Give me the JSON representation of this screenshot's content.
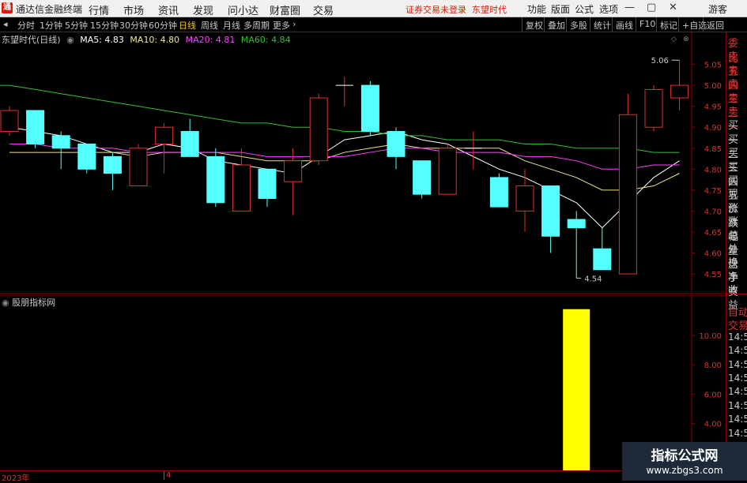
{
  "titlebar": {
    "app_name": "通达信金融终端",
    "menu": [
      "行情",
      "市场",
      "资讯",
      "发现",
      "问小达",
      "财富圈",
      "交易"
    ],
    "notice": "证券交易未登录",
    "notice_stock": "东望时代",
    "right_menu": [
      "功能",
      "版面",
      "公式",
      "选项"
    ],
    "user": "游客"
  },
  "toolbar": {
    "periods": [
      "分时",
      "1分钟",
      "5分钟",
      "15分钟",
      "30分钟",
      "60分钟",
      "日线",
      "周线",
      "月线",
      "多周期",
      "更多"
    ],
    "active_period": "日线",
    "right_buttons": [
      "复权",
      "叠加",
      "多股",
      "统计",
      "画线",
      "F10",
      "标记",
      "+自选",
      "返回"
    ]
  },
  "chart_info": {
    "stock_title": "东望时代(日线)",
    "ma5_label": "MA5: 4.83",
    "ma10_label": "MA10: 4.80",
    "ma20_label": "MA20: 4.81",
    "ma60_label": "MA60: 4.84",
    "colors": {
      "ma5": "#ffffff",
      "ma10": "#f0e68c",
      "ma20": "#ff40ff",
      "ma60": "#30c030",
      "up": "#e03030",
      "down": "#54ffff",
      "grid": "#8b0000",
      "bar": "#ffff00"
    }
  },
  "indicator": {
    "title": "股朋指标网"
  },
  "right_panel": {
    "items_top": [
      "委比",
      "卖五",
      "卖四",
      "卖三",
      "卖二",
      "卖一",
      "买一",
      "买二",
      "买三",
      "买四",
      "买五",
      "现价",
      "涨跌",
      "涨幅",
      "总量",
      "外盘",
      "换手",
      "净资",
      "收益"
    ],
    "items_bottom": [
      "自动",
      "交易",
      "14:56",
      "14:56",
      "14:56",
      "14:56",
      "14:56",
      "14:56",
      "14:56",
      "14:5"
    ]
  },
  "bottom": {
    "year_label": "2023年",
    "month_label": "4"
  },
  "watermark": {
    "line1": "指标公式网",
    "line2": "www.zbgs3.com"
  },
  "chart_data": [
    {
      "type": "candlestick",
      "title": "",
      "ylim": [
        4.52,
        5.1
      ],
      "y_ticks": [
        4.55,
        4.6,
        4.65,
        4.7,
        4.75,
        4.8,
        4.85,
        4.9,
        4.95,
        5.0,
        5.05
      ],
      "y_tick_labels": [
        "4.55",
        "4.60",
        "4.65",
        "4.70",
        "4.75",
        "4.80",
        "4.85",
        "4.90",
        "4.95",
        "5.00",
        "5.05"
      ],
      "annotations": [
        {
          "text": "5.06",
          "value": 5.06,
          "index": 26
        },
        {
          "text": "4.54",
          "value": 4.54,
          "index": 22
        }
      ],
      "candles": [
        {
          "open": 4.89,
          "close": 4.94,
          "high": 4.95,
          "low": 4.88
        },
        {
          "open": 4.94,
          "close": 4.86,
          "high": 4.94,
          "low": 4.85
        },
        {
          "open": 4.88,
          "close": 4.85,
          "high": 4.89,
          "low": 4.8
        },
        {
          "open": 4.86,
          "close": 4.8,
          "high": 4.86,
          "low": 4.79
        },
        {
          "open": 4.83,
          "close": 4.79,
          "high": 4.84,
          "low": 4.75
        },
        {
          "open": 4.76,
          "close": 4.85,
          "high": 4.86,
          "low": 4.76
        },
        {
          "open": 4.86,
          "close": 4.9,
          "high": 4.91,
          "low": 4.79
        },
        {
          "open": 4.89,
          "close": 4.83,
          "high": 4.92,
          "low": 4.83
        },
        {
          "open": 4.83,
          "close": 4.72,
          "high": 4.85,
          "low": 4.71
        },
        {
          "open": 4.7,
          "close": 4.81,
          "high": 4.85,
          "low": 4.7
        },
        {
          "open": 4.8,
          "close": 4.73,
          "high": 4.8,
          "low": 4.71
        },
        {
          "open": 4.77,
          "close": 4.82,
          "high": 4.85,
          "low": 4.69
        },
        {
          "open": 4.82,
          "close": 4.97,
          "high": 4.98,
          "low": 4.81
        },
        {
          "open": 5.0,
          "close": 5.0,
          "high": 5.02,
          "low": 4.95
        },
        {
          "open": 5.0,
          "close": 4.89,
          "high": 5.01,
          "low": 4.88
        },
        {
          "open": 4.89,
          "close": 4.83,
          "high": 4.9,
          "low": 4.8
        },
        {
          "open": 4.82,
          "close": 4.74,
          "high": 4.82,
          "low": 4.73
        },
        {
          "open": 4.74,
          "close": 4.85,
          "high": 4.86,
          "low": 4.74
        },
        {
          "open": 4.85,
          "close": 4.85,
          "high": 4.89,
          "low": 4.8
        },
        {
          "open": 4.78,
          "close": 4.71,
          "high": 4.79,
          "low": 4.71
        },
        {
          "open": 4.7,
          "close": 4.76,
          "high": 4.8,
          "low": 4.65
        },
        {
          "open": 4.76,
          "close": 4.64,
          "high": 4.76,
          "low": 4.6
        },
        {
          "open": 4.68,
          "close": 4.66,
          "high": 4.7,
          "low": 4.54
        },
        {
          "open": 4.61,
          "close": 4.56,
          "high": 4.66,
          "low": 4.56
        },
        {
          "open": 4.55,
          "close": 4.93,
          "high": 4.98,
          "low": 4.55
        },
        {
          "open": 4.9,
          "close": 4.99,
          "high": 5.0,
          "low": 4.89
        },
        {
          "open": 4.97,
          "close": 5.0,
          "high": 5.06,
          "low": 4.94
        }
      ],
      "series": [
        {
          "name": "MA5",
          "values": [
            4.9,
            4.89,
            4.88,
            4.86,
            4.84,
            4.84,
            4.86,
            4.85,
            4.82,
            4.81,
            4.8,
            4.79,
            4.83,
            4.87,
            4.88,
            4.89,
            4.87,
            4.86,
            4.83,
            4.8,
            4.78,
            4.75,
            4.72,
            4.66,
            4.72,
            4.78,
            4.82
          ]
        },
        {
          "name": "MA10",
          "values": [
            4.84,
            4.84,
            4.84,
            4.84,
            4.84,
            4.83,
            4.84,
            4.84,
            4.84,
            4.83,
            4.82,
            4.82,
            4.82,
            4.84,
            4.85,
            4.86,
            4.85,
            4.85,
            4.85,
            4.85,
            4.82,
            4.8,
            4.78,
            4.75,
            4.75,
            4.76,
            4.79
          ]
        },
        {
          "name": "MA20",
          "values": [
            4.86,
            4.86,
            4.85,
            4.85,
            4.85,
            4.84,
            4.84,
            4.84,
            4.84,
            4.84,
            4.83,
            4.83,
            4.83,
            4.83,
            4.84,
            4.85,
            4.85,
            4.84,
            4.84,
            4.84,
            4.83,
            4.83,
            4.82,
            4.8,
            4.8,
            4.81,
            4.81
          ]
        },
        {
          "name": "MA60",
          "values": [
            5.0,
            4.99,
            4.98,
            4.97,
            4.96,
            4.95,
            4.94,
            4.93,
            4.92,
            4.91,
            4.91,
            4.9,
            4.9,
            4.89,
            4.89,
            4.88,
            4.88,
            4.87,
            4.87,
            4.87,
            4.86,
            4.86,
            4.85,
            4.85,
            4.85,
            4.84,
            4.84
          ]
        }
      ]
    },
    {
      "type": "bar",
      "title": "",
      "ylim": [
        1.0,
        12.0
      ],
      "y_ticks": [
        2.0,
        4.0,
        6.0,
        8.0,
        10.0
      ],
      "y_tick_labels": [
        "2.00",
        "4.00",
        "6.00",
        "8.00",
        "10.00"
      ],
      "bars": [
        {
          "index": 22,
          "value": 11.8
        }
      ]
    }
  ]
}
